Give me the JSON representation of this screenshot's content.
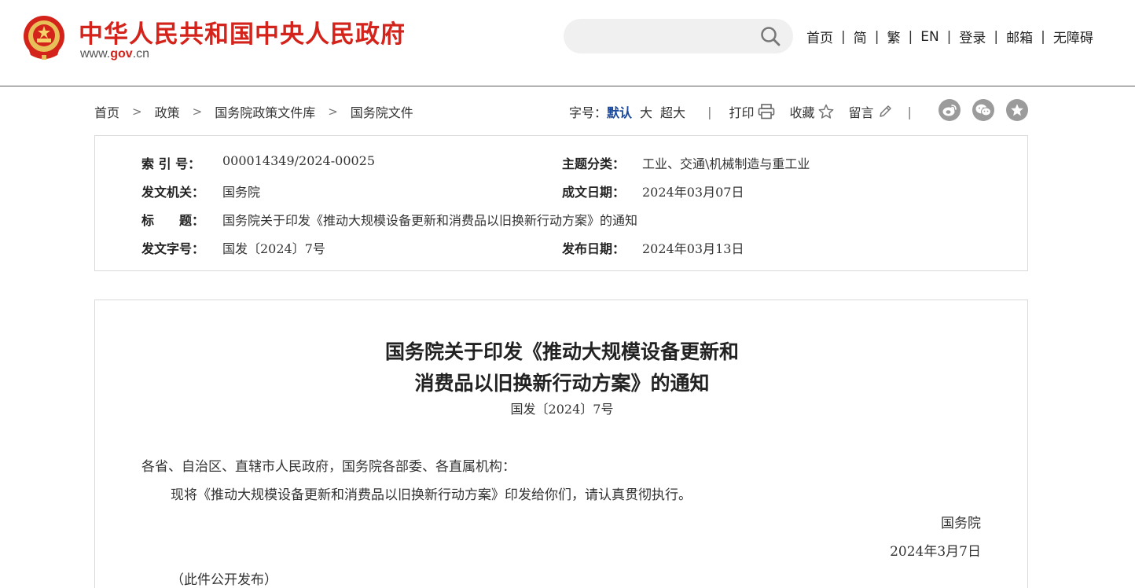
{
  "header": {
    "site_title": "中华人民共和国中央人民政府",
    "url_prefix": "www.",
    "url_gov": "gov",
    "url_suffix": ".cn",
    "search_placeholder": "",
    "nav": [
      "首页",
      "简",
      "繁",
      "EN",
      "登录",
      "邮箱",
      "无障碍"
    ],
    "nav_sep": "|"
  },
  "breadcrumb": [
    "首页",
    "政策",
    "国务院政策文件库",
    "国务院文件"
  ],
  "breadcrumb_sep": ">",
  "tools": {
    "font_size_label": "字号：",
    "font_default": "默认",
    "font_large": "大",
    "font_xlarge": "超大",
    "sep": "|",
    "print": "打印",
    "collect": "收藏",
    "comment": "留言"
  },
  "info": {
    "index_label": "索 引 号：",
    "index_value": "000014349/2024-00025",
    "topic_label": "主题分类：",
    "topic_value": "工业、交通\\机械制造与重工业",
    "issuer_label": "发文机关：",
    "issuer_value": "国务院",
    "date_written_label": "成文日期：",
    "date_written_value": "2024年03月07日",
    "title_label": "标　　题：",
    "title_value": "国务院关于印发《推动大规模设备更新和消费品以旧换新行动方案》的通知",
    "docno_label": "发文字号：",
    "docno_value": "国发〔2024〕7号",
    "date_published_label": "发布日期：",
    "date_published_value": "2024年03月13日"
  },
  "article": {
    "title_line1": "国务院关于印发《推动大规模设备更新和",
    "title_line2": "消费品以旧换新行动方案》的通知",
    "doc_number": "国发〔2024〕7号",
    "salutation": "各省、自治区、直辖市人民政府，国务院各部委、各直属机构：",
    "body": "现将《推动大规模设备更新和消费品以旧换新行动方案》印发给你们，请认真贯彻执行。",
    "signature": "国务院",
    "date": "2024年3月7日",
    "note": "（此件公开发布）"
  },
  "colors": {
    "brand_red": "#d3231b",
    "link_blue": "#1a4a9e",
    "icon_gray": "#9b9b9b"
  },
  "icons": [
    "national-emblem-icon",
    "search-icon",
    "printer-icon",
    "star-icon",
    "pencil-icon",
    "weibo-icon",
    "wechat-icon",
    "favorite-icon"
  ]
}
